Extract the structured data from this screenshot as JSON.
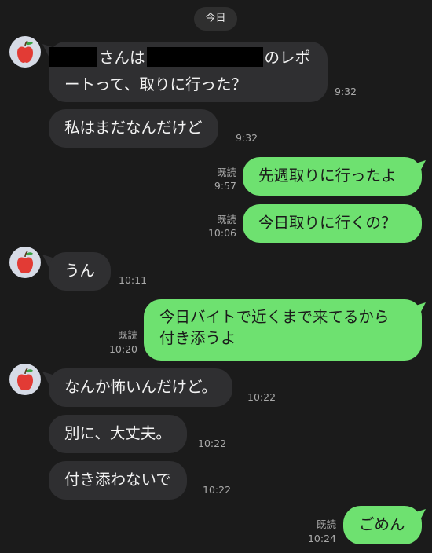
{
  "chat": {
    "date_label": "今日",
    "messages": [
      {
        "from": "them",
        "line1": "さんは",
        "line1b": "のレポ",
        "line2": "ートって、取りに行った？",
        "time": "9:32",
        "redacted": true
      },
      {
        "from": "them",
        "text": "私はまだなんだけど",
        "time": "9:32"
      },
      {
        "from": "me",
        "text": "先週取りに行ったよ",
        "read": "既読",
        "time": "9:57"
      },
      {
        "from": "me",
        "text": "今日取りに行くの？",
        "read": "既読",
        "time": "10:06"
      },
      {
        "from": "them",
        "text": "うん",
        "time": "10:11"
      },
      {
        "from": "me",
        "line1": "今日バイトで近くまで来てるから",
        "line2": "付き添うよ",
        "read": "既読",
        "time": "10:20"
      },
      {
        "from": "them",
        "text": "なんか怖いんだけど。",
        "time": "10:22"
      },
      {
        "from": "them",
        "text": "別に、大丈夫。",
        "time": "10:22"
      },
      {
        "from": "them",
        "text": "付き添わないで",
        "time": "10:22"
      },
      {
        "from": "me",
        "text": "ごめん",
        "read": "既読",
        "time": "10:24"
      }
    ]
  },
  "contact": {
    "avatar_icon": "apple-icon"
  },
  "colors": {
    "background": "#1b1b1b",
    "incoming_bubble": "#2f2f31",
    "outgoing_bubble": "#6ee170",
    "meta_text": "#a9a9a9"
  }
}
